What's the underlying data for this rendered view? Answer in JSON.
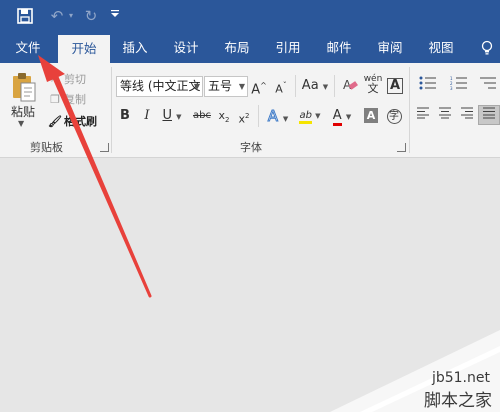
{
  "quick_access": {
    "save_icon": "floppy-disk-icon",
    "undo_icon": "undo-icon",
    "redo_icon": "redo-icon",
    "customize_icon": "customize-dropdown-icon"
  },
  "tabs": [
    {
      "label": "文件",
      "active": false
    },
    {
      "label": "开始",
      "active": true
    },
    {
      "label": "插入",
      "active": false
    },
    {
      "label": "设计",
      "active": false
    },
    {
      "label": "布局",
      "active": false
    },
    {
      "label": "引用",
      "active": false
    },
    {
      "label": "邮件",
      "active": false
    },
    {
      "label": "审阅",
      "active": false
    },
    {
      "label": "视图",
      "active": false
    }
  ],
  "tell_me_icon": "lightbulb-icon",
  "clipboard": {
    "group_label": "剪贴板",
    "paste_label": "粘贴",
    "cut_label": "剪切",
    "copy_label": "复制",
    "format_painter_label": "格式刷"
  },
  "font": {
    "group_label": "字体",
    "font_name": "等线 (中文正文",
    "font_size": "五号",
    "grow_label": "A",
    "shrink_label": "A",
    "case_label": "Aa",
    "phonetic_label": "wén",
    "phonetic_sub": "文",
    "border_label": "A",
    "bold": "B",
    "italic": "I",
    "underline": "U",
    "strike": "abc",
    "subscript": "x",
    "superscript": "x",
    "effects_label": "A",
    "highlight_label": "ab",
    "color_label": "A",
    "shading_label": "A",
    "enclose_label": "字"
  },
  "colors": {
    "title_bar": "#2b579a",
    "ribbon": "#f3f3f3",
    "document": "#e6e6e6",
    "arrow": "#e8413b",
    "highlight": "#f5e400",
    "font_color": "#e00000"
  },
  "watermark": {
    "url": "jb51.net",
    "site_name": "脚本之家"
  }
}
